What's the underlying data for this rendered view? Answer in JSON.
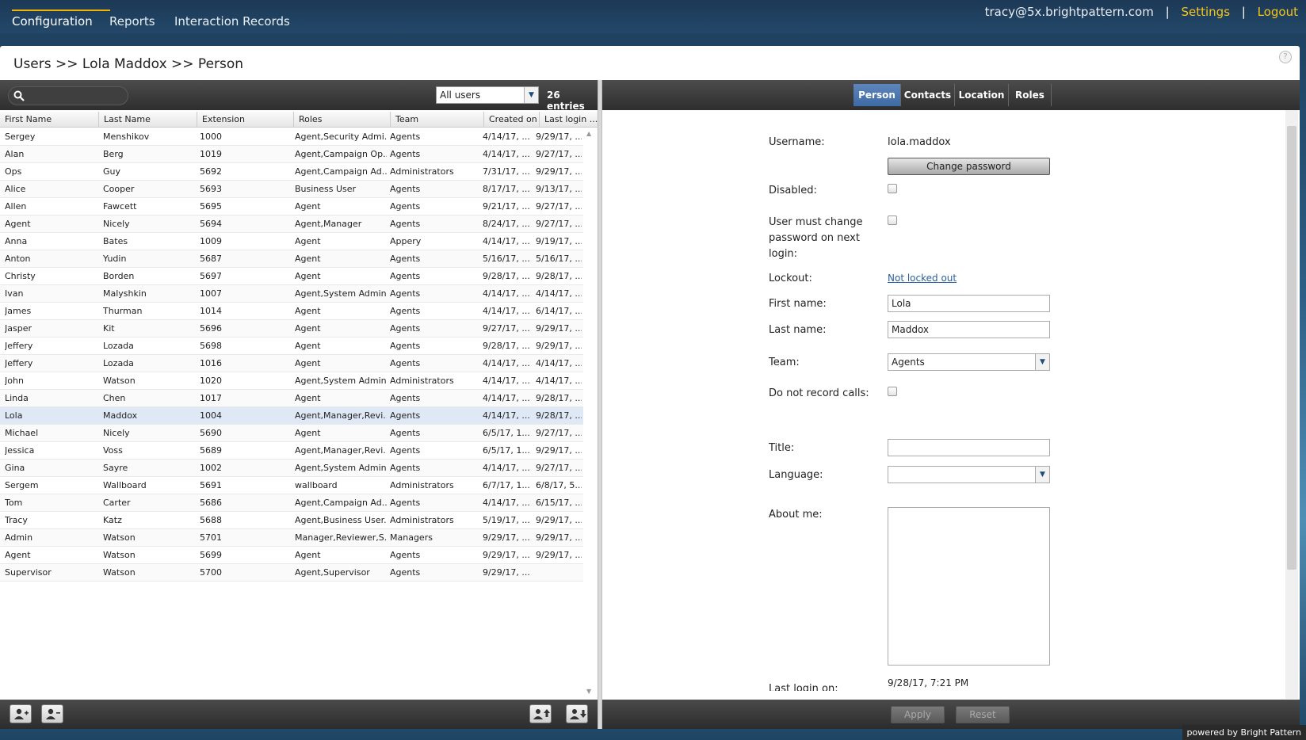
{
  "nav": {
    "tabs": [
      "Configuration",
      "Reports",
      "Interaction Records"
    ],
    "user_email": "tracy@5x.brightpattern.com",
    "settings": "Settings",
    "logout": "Logout",
    "separator": "|"
  },
  "breadcrumb": "Users >> Lola Maddox >> Person",
  "help_glyph": "?",
  "left": {
    "filter_value": "All users",
    "entries": "26 entries",
    "columns": [
      "First Name",
      "Last Name",
      "Extension",
      "Roles",
      "Team",
      "Created on",
      "Last login ..."
    ],
    "rows": [
      [
        "Sergey",
        "Menshikov",
        "1000",
        "Agent,Security Admi...",
        "Agents",
        "4/14/17, ...",
        "9/29/17, ..."
      ],
      [
        "Alan",
        "Berg",
        "1019",
        "Agent,Campaign Op...",
        "Agents",
        "4/14/17, ...",
        "9/27/17, ..."
      ],
      [
        "Ops",
        "Guy",
        "5692",
        "Agent,Campaign Ad...",
        "Administrators",
        "7/31/17, ...",
        "9/29/17, ..."
      ],
      [
        "Alice",
        "Cooper",
        "5693",
        "Business User",
        "Agents",
        "8/17/17, ...",
        "9/13/17, ..."
      ],
      [
        "Allen",
        "Fawcett",
        "5695",
        "Agent",
        "Agents",
        "9/21/17, ...",
        "9/27/17, ..."
      ],
      [
        "Agent",
        "Nicely",
        "5694",
        "Agent,Manager",
        "Agents",
        "8/24/17, ...",
        "9/27/17, ..."
      ],
      [
        "Anna",
        "Bates",
        "1009",
        "Agent",
        "Appery",
        "4/14/17, ...",
        "9/19/17, ..."
      ],
      [
        "Anton",
        "Yudin",
        "5687",
        "Agent",
        "Agents",
        "5/16/17, ...",
        "5/16/17, ..."
      ],
      [
        "Christy",
        "Borden",
        "5697",
        "Agent",
        "Agents",
        "9/28/17, ...",
        "9/28/17, ..."
      ],
      [
        "Ivan",
        "Malyshkin",
        "1007",
        "Agent,System Admin...",
        "Agents",
        "4/14/17, ...",
        "4/14/17, ..."
      ],
      [
        "James",
        "Thurman",
        "1014",
        "Agent",
        "Agents",
        "4/14/17, ...",
        "6/14/17, ..."
      ],
      [
        "Jasper",
        "Kit",
        "5696",
        "Agent",
        "Agents",
        "9/27/17, ...",
        "9/29/17, ..."
      ],
      [
        "Jeffery",
        "Lozada",
        "5698",
        "Agent",
        "Agents",
        "9/28/17, ...",
        "9/29/17, ..."
      ],
      [
        "Jeffery",
        "Lozada",
        "1016",
        "Agent",
        "Agents",
        "4/14/17, ...",
        "4/14/17, ..."
      ],
      [
        "John",
        "Watson",
        "1020",
        "Agent,System Admin...",
        "Administrators",
        "4/14/17, ...",
        "4/14/17, ..."
      ],
      [
        "Linda",
        "Chen",
        "1017",
        "Agent",
        "Agents",
        "4/14/17, ...",
        "9/28/17, ..."
      ],
      [
        "Lola",
        "Maddox",
        "1004",
        "Agent,Manager,Revi...",
        "Agents",
        "4/14/17, ...",
        "9/28/17, ..."
      ],
      [
        "Michael",
        "Nicely",
        "5690",
        "Agent",
        "Agents",
        "6/5/17, 1...",
        "9/27/17, ..."
      ],
      [
        "Jessica",
        "Voss",
        "5689",
        "Agent,Manager,Revi...",
        "Agents",
        "6/5/17, 1...",
        "9/29/17, ..."
      ],
      [
        "Gina",
        "Sayre",
        "1002",
        "Agent,System Admin...",
        "Agents",
        "4/14/17, ...",
        "9/27/17, ..."
      ],
      [
        "Sergem",
        "Wallboard",
        "5691",
        "wallboard",
        "Administrators",
        "6/7/17, 1...",
        "6/8/17, 5..."
      ],
      [
        "Tom",
        "Carter",
        "5686",
        "Agent,Campaign Ad...",
        "Agents",
        "4/14/17, ...",
        "6/15/17, ..."
      ],
      [
        "Tracy",
        "Katz",
        "5688",
        "Agent,Business User...",
        "Administrators",
        "5/19/17, ...",
        "9/29/17, ..."
      ],
      [
        "Admin",
        "Watson",
        "5701",
        "Manager,Reviewer,S...",
        "Managers",
        "9/29/17, ...",
        "9/29/17, ..."
      ],
      [
        "Agent",
        "Watson",
        "5699",
        "Agent",
        "Agents",
        "9/29/17, ...",
        "9/29/17, ..."
      ],
      [
        "Supervisor",
        "Watson",
        "5700",
        "Agent,Supervisor",
        "Agents",
        "9/29/17, ...",
        ""
      ]
    ],
    "selected_row": 16
  },
  "right": {
    "tabs": [
      "Person",
      "Contacts",
      "Location",
      "Roles"
    ],
    "active_tab": "Person",
    "form": {
      "username_label": "Username:",
      "username_value": "lola.maddox",
      "change_password": "Change password",
      "disabled_label": "Disabled:",
      "must_change_label": "User must change password on next login:",
      "lockout_label": "Lockout:",
      "lockout_value": "Not locked out",
      "first_name_label": "First name:",
      "first_name_value": "Lola",
      "last_name_label": "Last name:",
      "last_name_value": "Maddox",
      "team_label": "Team:",
      "team_value": "Agents",
      "no_record_label": "Do not record calls:",
      "title_label": "Title:",
      "title_value": "",
      "language_label": "Language:",
      "language_value": "",
      "about_label": "About me:",
      "last_login_label": "Last login on:",
      "last_login_value": "9/28/17, 7:21 PM"
    },
    "apply": "Apply",
    "reset": "Reset"
  },
  "powered_by": "powered by Bright Pattern",
  "colors": {
    "accent": "#f5c518",
    "active_tab": "#4a76b0",
    "selected_row": "#dfe9f6"
  }
}
